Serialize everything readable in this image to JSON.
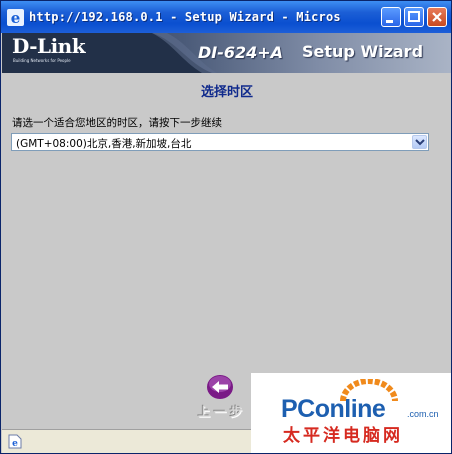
{
  "window": {
    "title": "http://192.168.0.1 - Setup Wizard - Micros"
  },
  "banner": {
    "logo": "D-Link",
    "tagline": "Building Networks for People",
    "model": "DI-624+A",
    "wizard": "Setup Wizard"
  },
  "page": {
    "title": "选择时区",
    "instruction": "请选一个适合您地区的时区，请按下一步继续"
  },
  "timezone": {
    "selected": "(GMT+08:00)北京,香港,新加坡,台北"
  },
  "nav": {
    "back_label": "上一步"
  },
  "watermark": {
    "brand": "PConline",
    "domain": ".com.cn",
    "chinese": "太平洋电脑网"
  },
  "colors": {
    "titlebar": "#0a4fd0",
    "page_title": "#102a8c",
    "content_bg": "#c9c9c9",
    "back_icon": "#8a1f8f",
    "watermark_blue": "#1d5fb0",
    "watermark_red": "#d62a20"
  },
  "icons": {
    "titlebar": "ie-icon",
    "back": "back-arrow-icon",
    "status": "page-icon"
  }
}
